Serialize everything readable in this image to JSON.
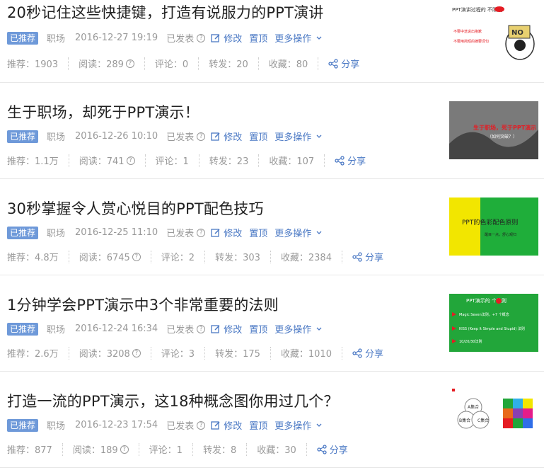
{
  "labels": {
    "recommended": "已推荐",
    "status": "已发表",
    "edit": "修改",
    "pin": "置顶",
    "more": "更多操作",
    "share": "分享"
  },
  "articles": [
    {
      "title": "20秒记住这些快捷键，打造有说服力的PPT演讲",
      "category": "职场",
      "date": "2016-12-27 19:19",
      "recommend": "推荐：1903",
      "read": "阅读：289",
      "comment": "评论：0",
      "forward": "转发：20",
      "collect": "收藏：80",
      "thumb_text": "PPT演讲过程的 不限制",
      "thumb_sub1": "不要中途说出抱歉",
      "thumb_sub2": "不要用简短的摘要词句"
    },
    {
      "title": "生于职场，却死于PPT演示！",
      "category": "职场",
      "date": "2016-12-26 10:10",
      "recommend": "推荐：1.1万",
      "read": "阅读：741",
      "comment": "评论：1",
      "forward": "转发：23",
      "collect": "收藏：107",
      "thumb_text": "生于职场，死于PPT演示",
      "thumb_sub1": "（如何突破？）"
    },
    {
      "title": "30秒掌握令人赏心悦目的PPT配色技巧",
      "category": "职场",
      "date": "2016-12-25 11:10",
      "recommend": "推荐：4.8万",
      "read": "阅读：6745",
      "comment": "评论：2",
      "forward": "转发：303",
      "collect": "收藏：2384",
      "thumb_text": "PPT的色彩配色原则",
      "thumb_sub1": "醒目一点，舒心观归"
    },
    {
      "title": "1分钟学会PPT演示中3个非常重要的法则",
      "category": "职场",
      "date": "2016-12-24 16:34",
      "recommend": "推荐：2.6万",
      "read": "阅读：3208",
      "comment": "评论：3",
      "forward": "转发：175",
      "collect": "收藏：1010",
      "thumb_text": "PPT演示的 个法则",
      "thumb_sub1": "Magic Seven法则，+7 个概念",
      "thumb_sub2": "KISS (Keep It Simple and Stupid) 法则",
      "thumb_sub3": "10/20/30法则"
    },
    {
      "title": "打造一流的PPT演示，这18种概念图你用过几个？",
      "category": "职场",
      "date": "2016-12-23 17:54",
      "recommend": "推荐：877",
      "read": "阅读：189",
      "comment": "评论：1",
      "forward": "转发：8",
      "collect": "收藏：30",
      "thumb_text": "A集合",
      "thumb_sub1": "B集合",
      "thumb_sub2": "C集合"
    }
  ]
}
